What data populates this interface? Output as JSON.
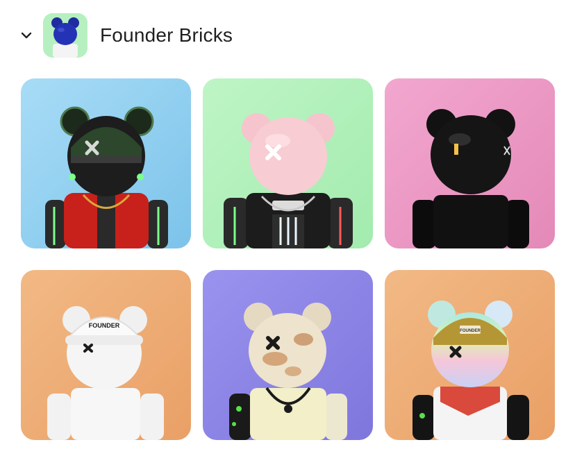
{
  "collection": {
    "title": "Founder Bricks",
    "expanded": true,
    "avatar_icon": "blue-bear-avatar"
  },
  "items": [
    {
      "bg": "#8fd1ef",
      "label": "",
      "icon": "cyber-helmet-bear-red-vest"
    },
    {
      "bg": "#b3f2bc",
      "label": "",
      "icon": "pink-bear-cyber-body"
    },
    {
      "bg": "#ee97c4",
      "label": "",
      "icon": "black-bear"
    },
    {
      "bg": "#eeaa74",
      "label": "FOUNDER",
      "icon": "white-bear-founder-cap"
    },
    {
      "bg": "#8b82e6",
      "label": "",
      "icon": "marble-bear-chain"
    },
    {
      "bg": "#eeaa74",
      "label": "FOUNDER",
      "icon": "pastel-bear-beanie"
    }
  ]
}
